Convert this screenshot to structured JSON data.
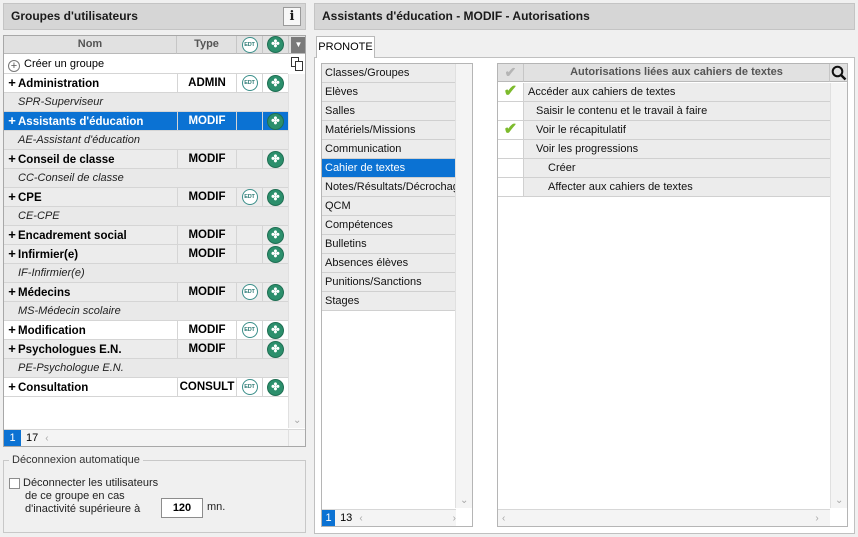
{
  "left_panel": {
    "title": "Groupes d'utilisateurs",
    "info_label": "i",
    "columns": {
      "name": "Nom",
      "type": "Type",
      "edt": "EDT"
    },
    "create_label": "Créer un groupe",
    "rows": [
      {
        "kind": "group",
        "name": "Administration",
        "type": "ADMIN",
        "edt": true,
        "leaf": true,
        "shaded": false,
        "selected": false
      },
      {
        "kind": "sub",
        "name": "SPR-Superviseur"
      },
      {
        "kind": "group",
        "name": "Assistants d'éducation",
        "type": "MODIF",
        "edt": false,
        "leaf": true,
        "shaded": false,
        "selected": true
      },
      {
        "kind": "sub",
        "name": "AE-Assistant d'éducation"
      },
      {
        "kind": "group",
        "name": "Conseil de classe",
        "type": "MODIF",
        "edt": false,
        "leaf": true,
        "shaded": true,
        "selected": false
      },
      {
        "kind": "sub",
        "name": "CC-Conseil de classe"
      },
      {
        "kind": "group",
        "name": "CPE",
        "type": "MODIF",
        "edt": true,
        "leaf": true,
        "shaded": true,
        "selected": false
      },
      {
        "kind": "sub",
        "name": "CE-CPE"
      },
      {
        "kind": "group",
        "name": "Encadrement social",
        "type": "MODIF",
        "edt": false,
        "leaf": true,
        "shaded": true,
        "selected": false
      },
      {
        "kind": "group",
        "name": "Infirmier(e)",
        "type": "MODIF",
        "edt": false,
        "leaf": true,
        "shaded": true,
        "selected": false
      },
      {
        "kind": "sub",
        "name": "IF-Infirmier(e)"
      },
      {
        "kind": "group",
        "name": "Médecins",
        "type": "MODIF",
        "edt": true,
        "leaf": true,
        "shaded": true,
        "selected": false
      },
      {
        "kind": "sub",
        "name": "MS-Médecin scolaire"
      },
      {
        "kind": "group",
        "name": "Modification",
        "type": "MODIF",
        "edt": true,
        "leaf": true,
        "shaded": false,
        "selected": false
      },
      {
        "kind": "group",
        "name": "Psychologues E.N.",
        "type": "MODIF",
        "edt": false,
        "leaf": true,
        "shaded": true,
        "selected": false
      },
      {
        "kind": "sub",
        "name": "PE-Psychologue E.N."
      },
      {
        "kind": "group",
        "name": "Consultation",
        "type": "CONSULT",
        "edt": true,
        "leaf": true,
        "shaded": false,
        "selected": false
      }
    ],
    "pager": {
      "current": "1",
      "total": "17"
    }
  },
  "auto_logout": {
    "legend": "Déconnexion automatique",
    "line1": "Déconnecter les utilisateurs",
    "line2": "de ce groupe en cas",
    "line3": "d'inactivité supérieure à",
    "minutes": "120",
    "unit": "mn."
  },
  "right_panel": {
    "title": "Assistants d'éducation - MODIF - Autorisations",
    "tab": "PRONOTE",
    "categories": [
      "Classes/Groupes",
      "Elèves",
      "Salles",
      "Matériels/Missions",
      "Communication",
      "Cahier de textes",
      "Notes/Résultats/Décrochage",
      "QCM",
      "Compétences",
      "Bulletins",
      "Absences élèves",
      "Punitions/Sanctions",
      "Stages"
    ],
    "selected_category": 5,
    "category_pager": {
      "current": "1",
      "total": "13"
    },
    "auth_header": "Autorisations liées aux cahiers de textes",
    "authorizations": [
      {
        "label": "Accéder aux cahiers de textes",
        "checked": true,
        "level": 0
      },
      {
        "label": "Saisir le contenu et le travail à faire",
        "checked": false,
        "level": 1
      },
      {
        "label": "Voir le récapitulatif",
        "checked": true,
        "level": 1
      },
      {
        "label": "Voir les progressions",
        "checked": false,
        "level": 1
      },
      {
        "label": "Créer",
        "checked": false,
        "level": 2
      },
      {
        "label": "Affecter aux cahiers de textes",
        "checked": false,
        "level": 2
      }
    ]
  },
  "icons": {
    "info": "info-icon",
    "menu": "dropdown-menu-icon",
    "add": "plus-circle-icon",
    "copy": "copy-icon",
    "edt": "edt-icon",
    "leaf": "leaf-icon",
    "check": "checkmark-icon",
    "search": "search-icon"
  },
  "colors": {
    "selection": "#0b72d3",
    "check": "#7dbb2d",
    "leaf": "#2c8f6c"
  }
}
